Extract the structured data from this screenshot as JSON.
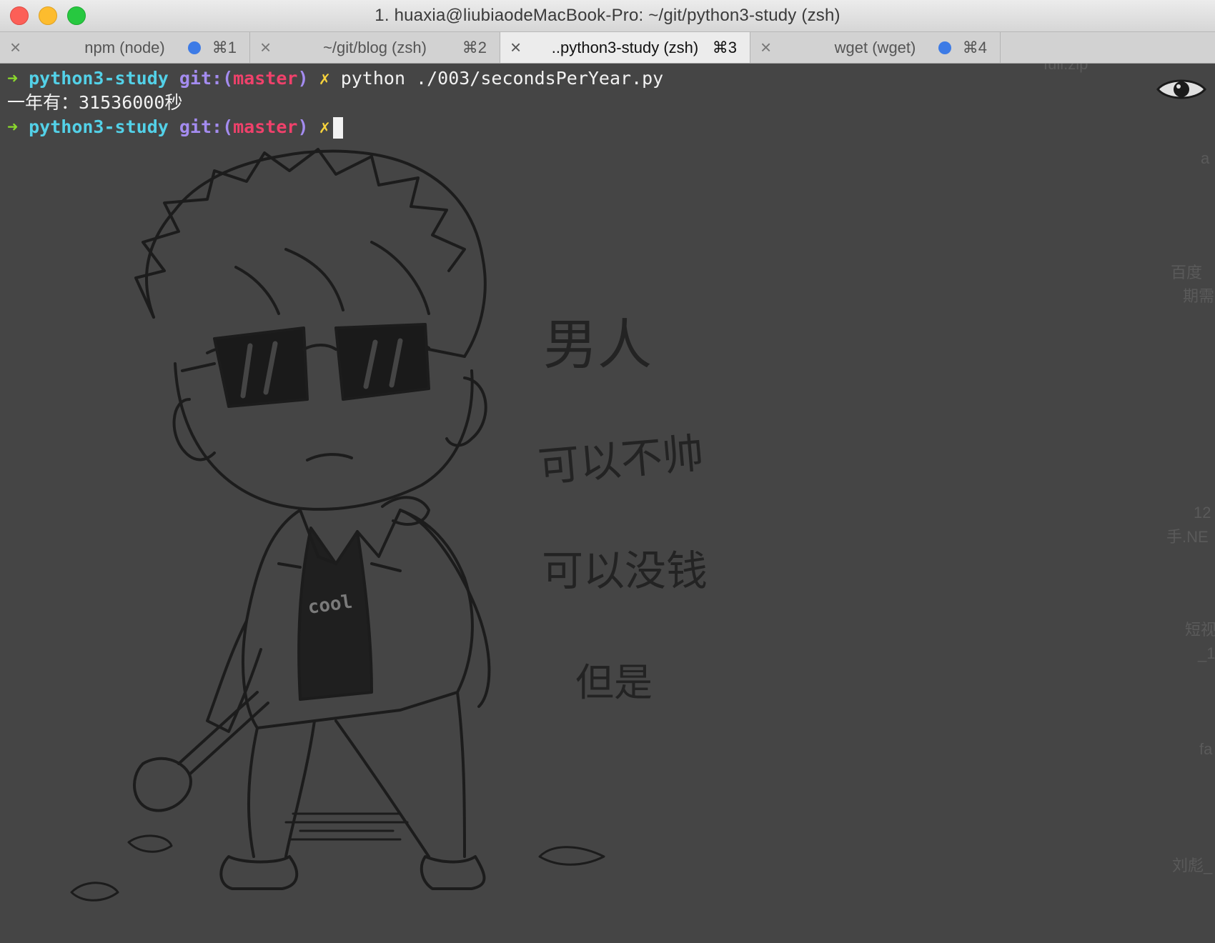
{
  "window": {
    "title": "1. huaxia@liubiaodeMacBook-Pro: ~/git/python3-study (zsh)"
  },
  "tabs": [
    {
      "label": "npm (node)",
      "shortcut": "⌘1",
      "close": "×",
      "activity_dot": true,
      "active": false
    },
    {
      "label": "~/git/blog (zsh)",
      "shortcut": "⌘2",
      "close": "×",
      "activity_dot": false,
      "active": false
    },
    {
      "label": "..python3-study (zsh)",
      "shortcut": "⌘3",
      "close": "×",
      "activity_dot": false,
      "active": true
    },
    {
      "label": "wget (wget)",
      "shortcut": "⌘4",
      "close": "×",
      "activity_dot": true,
      "active": false
    }
  ],
  "terminal": {
    "lines": [
      {
        "arrow": "➜",
        "dir": "python3-study",
        "git_prefix": "git:(",
        "branch": "master",
        "git_suffix": ")",
        "dirty": "✗",
        "command": "python ./003/secondsPerYear.py"
      },
      {
        "output": "一年有：31536000秒"
      },
      {
        "arrow": "➜",
        "dir": "python3-study",
        "git_prefix": "git:(",
        "branch": "master",
        "git_suffix": ")",
        "dirty": "✗",
        "command": ""
      }
    ]
  },
  "background_text": {
    "line1": "男人",
    "line2": "可以不帅",
    "line3": "可以没钱",
    "line4": "但是",
    "shirt": "cool",
    "edge_fragments": [
      "full.zip",
      "a",
      "百度",
      "期需",
      "12",
      "手.NE",
      "短视",
      "_1",
      "fa",
      "刘彪_"
    ]
  },
  "colors": {
    "background": "#454545",
    "prompt_arrow": "#8bd92c",
    "directory": "#53d1e8",
    "git": "#a48cf0",
    "branch": "#f0416b",
    "dirty_marker": "#f7d33c",
    "tab_dot": "#3d7be6"
  },
  "icons": {
    "eye": "eye-icon"
  }
}
